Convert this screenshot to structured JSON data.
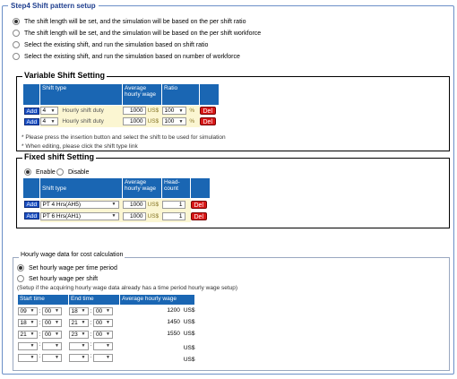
{
  "step_title": "Step4  Shift pattern setup",
  "options": [
    "The shift length will be set, and the simulation will be based on the per shift ratio",
    "The shift length will be set, and the simulation will be based on the per shift workforce",
    "Select the existing shift, and run the simulation based on shift ratio",
    "Select the existing shift, and run the simulation based on number of workforce"
  ],
  "variable": {
    "title": "Variable Shift Setting",
    "headers": {
      "shift_type": "Shift type",
      "avg_wage": "Average hourly wage",
      "ratio": "Ratio"
    },
    "rows": [
      {
        "add": "Add",
        "num": "4",
        "duty": "Hourly shift duty",
        "wage": "1000",
        "unit": "US$",
        "ratio": "100",
        "pct": "%",
        "del": "Del"
      },
      {
        "add": "Add",
        "num": "4",
        "duty": "Hourly shift duty",
        "wage": "1000",
        "unit": "US$",
        "ratio": "100",
        "pct": "%",
        "del": "Del"
      }
    ],
    "note1": "* Please press the insertion button and select the shift to be used for simulation",
    "note2": "* When editing, please click the shift type link"
  },
  "fixed": {
    "title": "Fixed shift Setting",
    "enable": "Enable",
    "disable": "Disable",
    "headers": {
      "shift_type": "Shift type",
      "avg_wage": "Average hourly wage",
      "headcount": "Head-count"
    },
    "rows": [
      {
        "add": "Add",
        "shift": "PT 4 Hrs(AH5)",
        "wage": "1000",
        "unit": "US$",
        "count": "1",
        "del": "Del"
      },
      {
        "add": "Add",
        "shift": "PT 6 Hrs(AH1)",
        "wage": "1000",
        "unit": "US$",
        "count": "1",
        "del": "Del"
      }
    ]
  },
  "hourly": {
    "title": "Hourly wage data for cost calculation",
    "opt1": "Set hourly wage per time period",
    "opt2": "Set hourly wage per shift",
    "note": "(Setup if the acquiring hourly wage data already has a time period hourly wage setup)",
    "headers": {
      "start": "Start time",
      "end": "End time",
      "avg": "Average hourly wage"
    },
    "rows": [
      {
        "sh": "09",
        "sm": "00",
        "eh": "18",
        "em": "00",
        "wage": "1200",
        "unit": "US$"
      },
      {
        "sh": "18",
        "sm": "00",
        "eh": "21",
        "em": "00",
        "wage": "1450",
        "unit": "US$"
      },
      {
        "sh": "21",
        "sm": "00",
        "eh": "23",
        "em": "00",
        "wage": "1550",
        "unit": "US$"
      },
      {
        "sh": "",
        "sm": "",
        "eh": "",
        "em": "",
        "wage": "",
        "unit": "US$"
      },
      {
        "sh": "",
        "sm": "",
        "eh": "",
        "em": "",
        "wage": "",
        "unit": "US$"
      }
    ],
    "colon": ":"
  },
  "colors": {
    "header_blue": "#1a66b3",
    "add_blue": "#1a4fc4",
    "del_red": "#d81818",
    "frame_blue": "#6b8fc7"
  }
}
